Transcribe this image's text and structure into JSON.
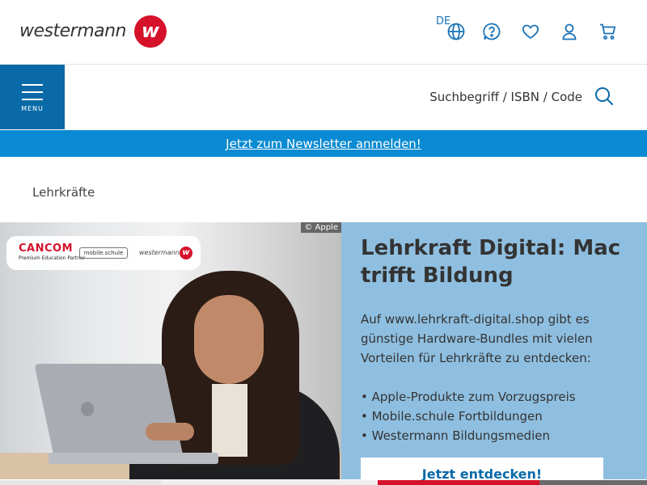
{
  "header": {
    "logo_text": "westermann",
    "logo_mark": "w",
    "language": "DE",
    "icons": [
      "globe-icon",
      "help-icon",
      "heart-icon",
      "user-icon",
      "cart-icon"
    ]
  },
  "search": {
    "menu_label": "MENU",
    "placeholder": "Suchbegriff / ISBN / Code"
  },
  "newsletter": {
    "link": "Jetzt zum Newsletter anmelden!"
  },
  "breadcrumb": {
    "current": "Lehrkräfte"
  },
  "hero": {
    "image_credit": "© Apple",
    "partner_logos": {
      "cancom": "CANCOM",
      "apple_partner": "Premium Education Partner",
      "mobile": "mobile.schule",
      "westermann": "westermann",
      "westermann_mark": "w"
    },
    "title": "Lehrkraft Digital: Mac trifft Bildung",
    "text": "Auf www.lehrkraft-digital.shop gibt es günstige Hardware-Bundles mit vielen Vorteilen für Lehrkräfte zu entdecken:",
    "bullets": [
      "• Apple-Produkte zum Vorzugspreis",
      "• Mobile.schule Fortbildungen",
      "• Westermann Bildungsmedien"
    ],
    "cta": "Jetzt entdecken!"
  },
  "colors": {
    "brand_red": "#d6112a",
    "brand_blue": "#0a6aa8",
    "newsletter_blue": "#0a8ad2",
    "panel_blue": "#8fbfe0"
  },
  "slider": {
    "segments": 4,
    "active_index": 2
  }
}
